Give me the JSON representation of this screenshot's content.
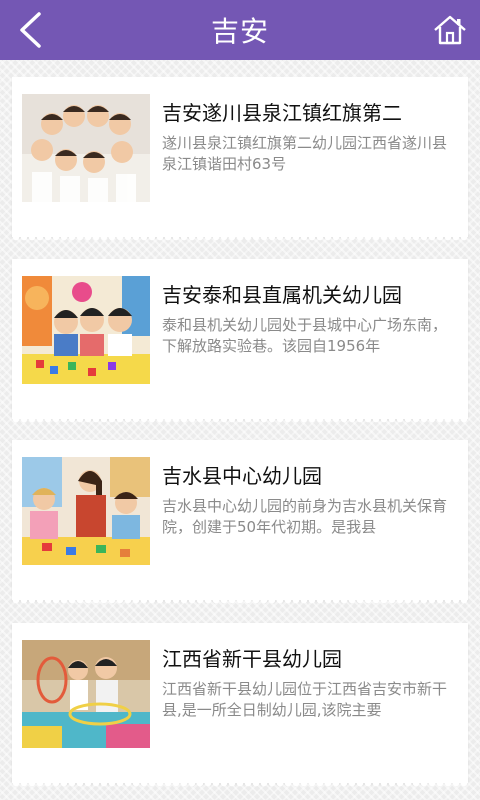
{
  "header": {
    "title": "吉安",
    "back_icon": "chevron-left-icon",
    "home_icon": "home-icon",
    "bg_color": "#7457b4"
  },
  "list": {
    "items": [
      {
        "title": "吉安遂川县泉江镇红旗第二",
        "description": "遂川县泉江镇红旗第二幼儿园江西省遂川县泉江镇谐田村63号",
        "thumbnail": "children-circle-photo"
      },
      {
        "title": "吉安泰和县直属机关幼儿园",
        "description": "泰和县机关幼儿园处于县城中心广场东南，下解放路实验巷。该园自1956年",
        "thumbnail": "children-playing-blocks-photo"
      },
      {
        "title": "吉水县中心幼儿园",
        "description": "吉水县中心幼儿园的前身为吉水县机关保育院，创建于50年代初期。是我县",
        "thumbnail": "teacher-with-children-photo"
      },
      {
        "title": "江西省新干县幼儿园",
        "description": "江西省新干县幼儿园位于江西省吉安市新干县,是一所全日制幼儿园,该院主要",
        "thumbnail": "children-hoop-photo"
      }
    ]
  }
}
